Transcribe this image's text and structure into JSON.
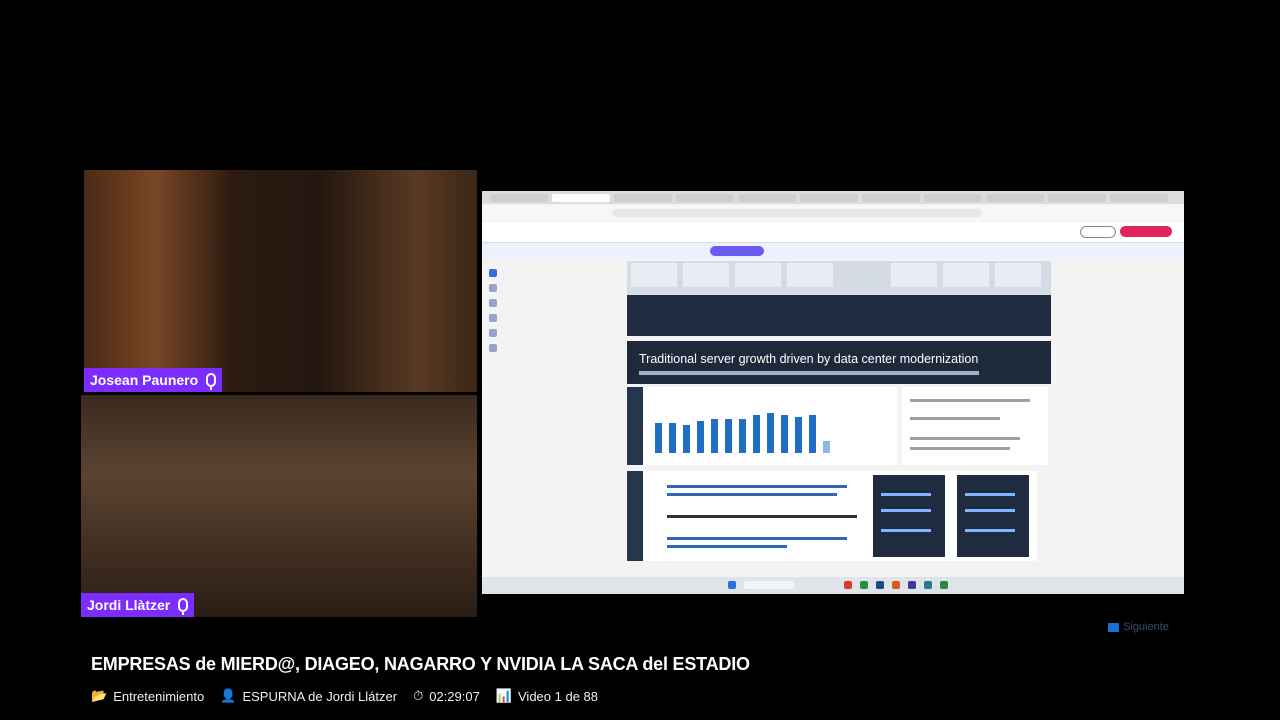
{
  "participants": [
    {
      "name": "Josean Paunero"
    },
    {
      "name": "Jordi Llàtzer"
    }
  ],
  "shared_slide": {
    "title": "Traditional server growth driven by data center modernization",
    "bar_count": 13
  },
  "next_label": "Siguiente",
  "video": {
    "title": "EMPRESAS de MIERD@, DIAGEO, NAGARRO Y NVIDIA LA SACA del ESTADIO",
    "category": "Entretenimiento",
    "channel": "ESPURNA de Jordi Llátzer",
    "duration": "02:29:07",
    "position": "Video 1 de 88"
  },
  "icons": {
    "category": "folder-icon",
    "channel": "person-icon",
    "duration": "stopwatch-icon",
    "position": "chart-icon",
    "next": "next-track-icon",
    "mic": "microphone-icon"
  },
  "colors": {
    "nametag": "#7b2cff",
    "slide_dark": "#1e2a3b",
    "bar_blue": "#1f6fc5"
  }
}
